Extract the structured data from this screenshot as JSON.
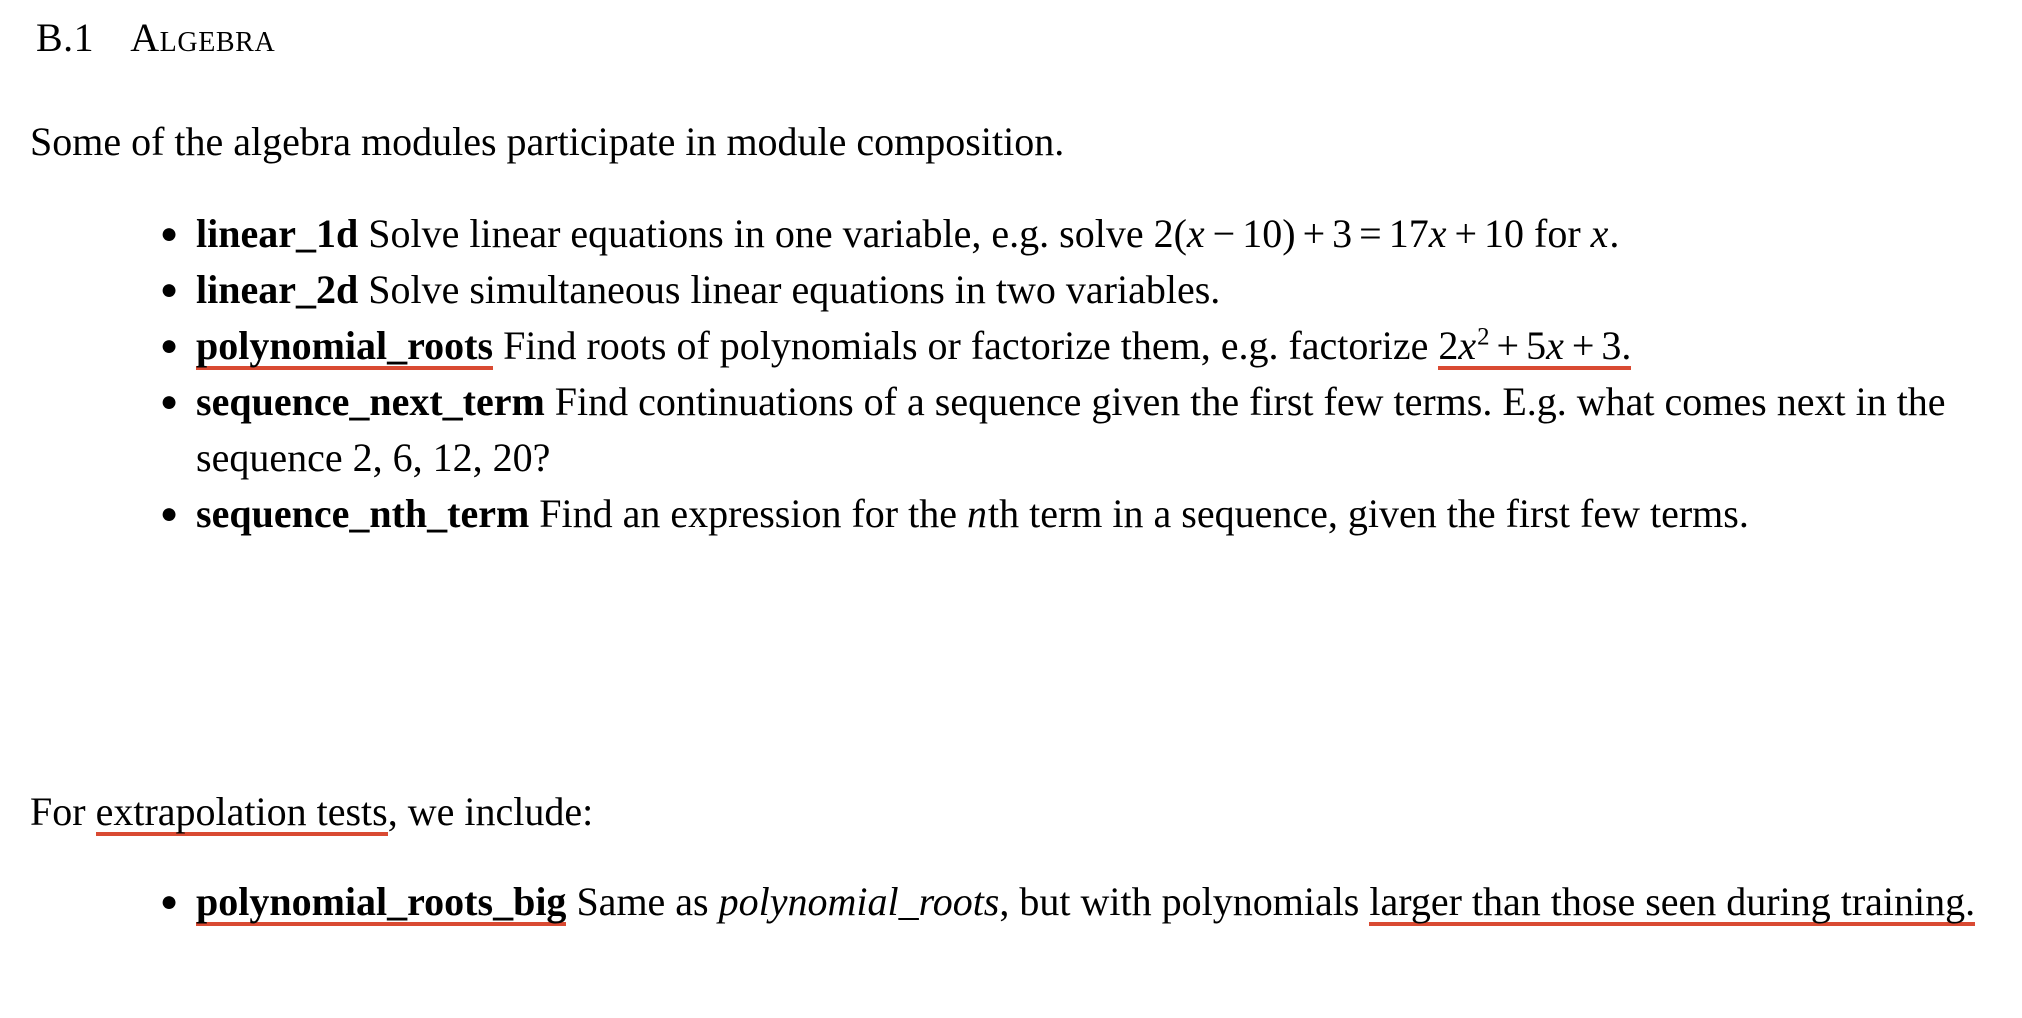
{
  "section": {
    "number": "B.1",
    "title": "Algebra"
  },
  "intro_paragraph": "Some of the algebra modules participate in module composition.",
  "extrapolation_paragraph": {
    "prefix": "For ",
    "highlight": "extrapolation tests",
    "suffix": ", we include:"
  },
  "algebra_modules": [
    {
      "name": "linear_1d",
      "name_underlined": false,
      "description_before": " Solve linear equations in one variable, e.g. solve ",
      "math": {
        "underlined": false,
        "tokens": [
          {
            "t": "num",
            "v": "2"
          },
          {
            "t": "paren",
            "v": "("
          },
          {
            "t": "var",
            "v": "x"
          },
          {
            "t": "op",
            "v": "−"
          },
          {
            "t": "num",
            "v": "10"
          },
          {
            "t": "paren",
            "v": ")"
          },
          {
            "t": "op",
            "v": "+"
          },
          {
            "t": "num",
            "v": "3"
          },
          {
            "t": "op",
            "v": "="
          },
          {
            "t": "num",
            "v": "17"
          },
          {
            "t": "var",
            "v": "x"
          },
          {
            "t": "op",
            "v": "+"
          },
          {
            "t": "num",
            "v": "10"
          }
        ]
      },
      "description_after": " for ",
      "trailing_math": {
        "tokens": [
          {
            "t": "var",
            "v": "x"
          },
          {
            "t": "plain",
            "v": "."
          }
        ]
      }
    },
    {
      "name": "linear_2d",
      "name_underlined": false,
      "description_before": " Solve simultaneous linear equations in two variables.",
      "math": null,
      "description_after": "",
      "trailing_math": null
    },
    {
      "name": "polynomial_roots",
      "name_underlined": true,
      "description_before": " Find roots of polynomials or factorize them, e.g. factorize ",
      "math": {
        "underlined": true,
        "tokens": [
          {
            "t": "num",
            "v": "2"
          },
          {
            "t": "var",
            "v": "x"
          },
          {
            "t": "sup",
            "v": "2"
          },
          {
            "t": "op",
            "v": "+"
          },
          {
            "t": "num",
            "v": "5"
          },
          {
            "t": "var",
            "v": "x"
          },
          {
            "t": "op",
            "v": "+"
          },
          {
            "t": "num",
            "v": "3"
          },
          {
            "t": "plain",
            "v": "."
          }
        ]
      },
      "description_after": "",
      "trailing_math": null
    },
    {
      "name": "sequence_next_term",
      "name_underlined": false,
      "description_before": " Find continuations of a sequence given the first few terms. E.g. what comes next in the sequence ",
      "math": {
        "underlined": false,
        "tokens": [
          {
            "t": "num",
            "v": "2,"
          },
          {
            "t": "num",
            "v": "6,"
          },
          {
            "t": "num",
            "v": "12,"
          },
          {
            "t": "num",
            "v": "20?"
          }
        ]
      },
      "description_after": "",
      "trailing_math": null
    },
    {
      "name": "sequence_nth_term",
      "name_underlined": false,
      "description_before": " Find an expression for the ",
      "math": {
        "underlined": false,
        "tokens": [
          {
            "t": "var",
            "v": "n"
          }
        ]
      },
      "description_after": "th term in a sequence, given the first few terms.",
      "trailing_math": null
    }
  ],
  "extrapolation_modules": [
    {
      "name": "polynomial_roots_big",
      "name_underlined": true,
      "text_1": " Same as ",
      "italic_ref": "polynomial_roots",
      "text_2": ", but with polynomials ",
      "highlight_tail": "larger than those seen during training."
    }
  ],
  "colors": {
    "annotation_underline": "#d94a32",
    "text": "#000000",
    "background": "#ffffff"
  }
}
